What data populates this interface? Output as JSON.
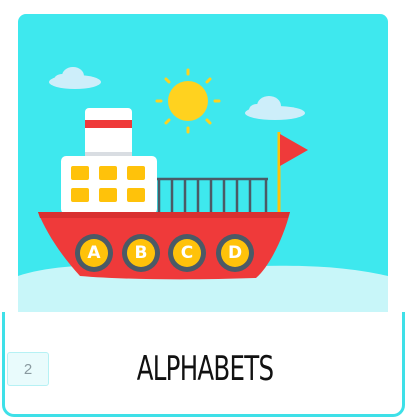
{
  "card": {
    "title": "ALPHABETS",
    "page_number": "2"
  },
  "illustration": {
    "portholes": [
      "A",
      "B",
      "C",
      "D"
    ],
    "colors": {
      "sky": "#3ee8ee",
      "sea": "#c8f6f9",
      "hull": "#ef3a3a",
      "sun": "#ffd21f",
      "cabin": "#ffffff",
      "window": "#ffc20a",
      "flag": "#ef3a3a",
      "cloud": "#cdeefa"
    }
  }
}
